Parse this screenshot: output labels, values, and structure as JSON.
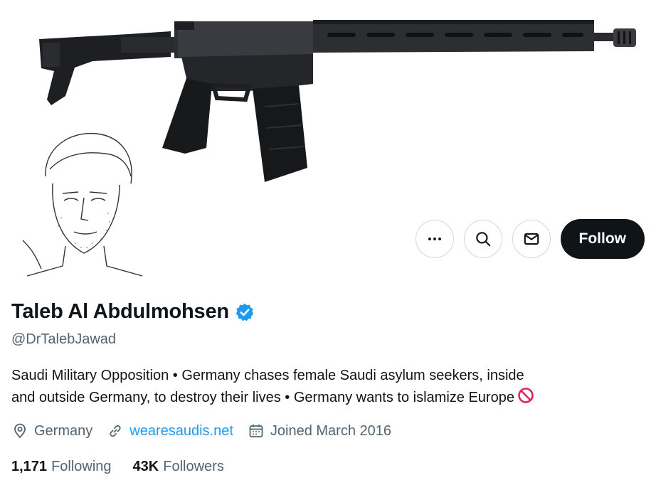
{
  "banner": {
    "image": "rifle-banner-image"
  },
  "avatar": {
    "image": "sketch-portrait-avatar"
  },
  "actions": {
    "more_icon": "more-horizontal-icon",
    "search_icon": "search-icon",
    "message_icon": "mail-icon",
    "follow_label": "Follow"
  },
  "profile": {
    "display_name": "Taleb Al Abdulmohsen",
    "verified_icon": "verified-badge-icon",
    "handle": "@DrTalebJawad",
    "bio_line1": "Saudi Military Opposition • Germany chases female Saudi asylum seekers, inside",
    "bio_line2": "and outside Germany, to destroy their lives • Germany wants to islamize Europe",
    "bio_emoji_icon": "no-entry-sign-icon"
  },
  "meta": {
    "location": "Germany",
    "website": "wearesaudis.net",
    "joined": "Joined March 2016"
  },
  "stats": {
    "following_count": "1,171",
    "following_label": "Following",
    "followers_count": "43K",
    "followers_label": "Followers"
  },
  "colors": {
    "text": "#0f1419",
    "secondary": "#536471",
    "link": "#1d9bf0",
    "verified": "#1d9bf0",
    "follow_bg": "#0f1419",
    "no_entry": "#e0245e"
  }
}
